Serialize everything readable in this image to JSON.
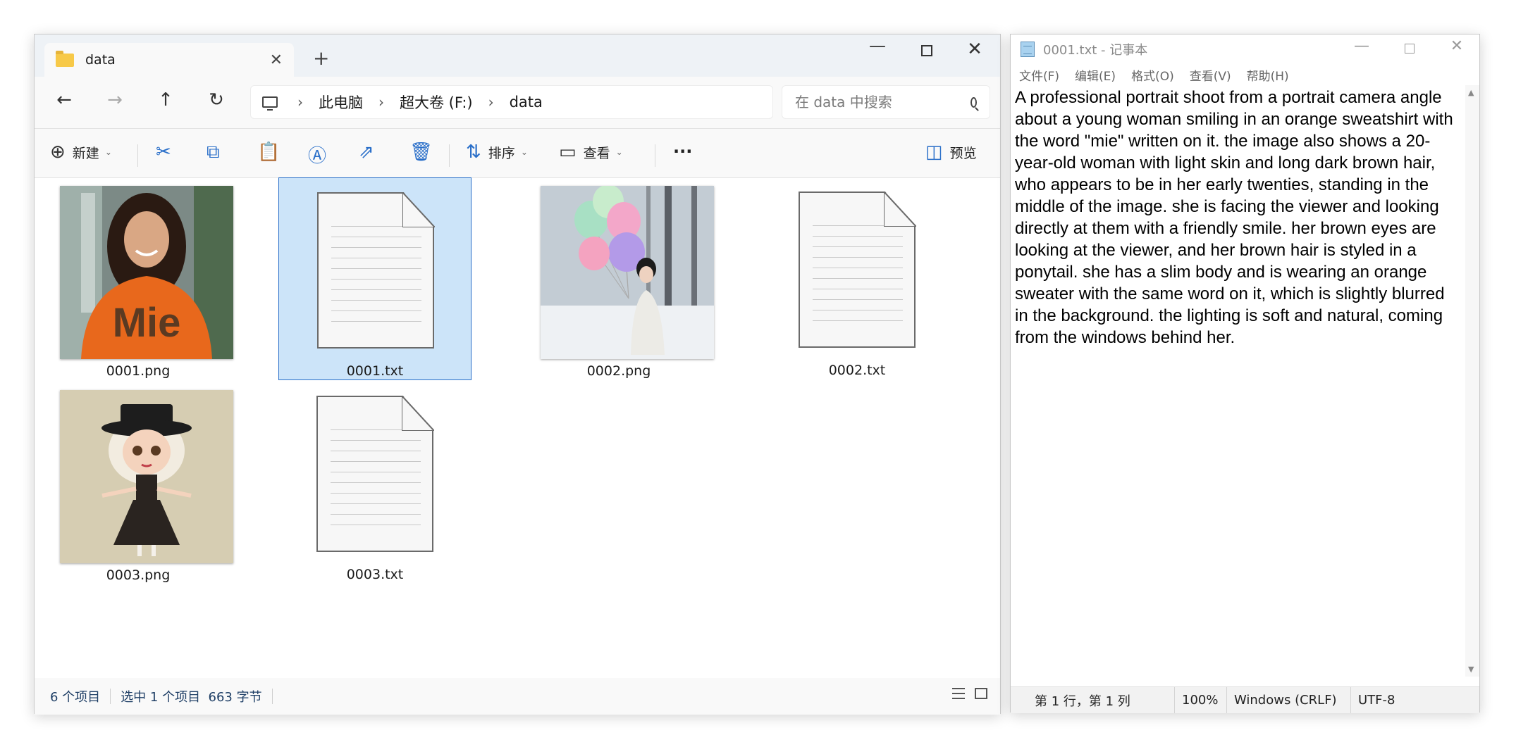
{
  "explorer": {
    "tab_title": "data",
    "nav": {
      "back": "←",
      "forward": "→",
      "up": "↑",
      "refresh": "↻"
    },
    "breadcrumb": [
      "此电脑",
      "超大卷 (F:)",
      "data"
    ],
    "search_placeholder": "在 data 中搜索",
    "toolbar": {
      "new_label": "新建",
      "sort_label": "排序",
      "view_label": "查看",
      "more_label": "···",
      "preview_label": "预览"
    },
    "files": [
      {
        "name": "0001.png",
        "kind": "image",
        "selected": false
      },
      {
        "name": "0001.txt",
        "kind": "text",
        "selected": true
      },
      {
        "name": "0002.png",
        "kind": "image",
        "selected": false
      },
      {
        "name": "0002.txt",
        "kind": "text",
        "selected": false
      },
      {
        "name": "0003.png",
        "kind": "image",
        "selected": false
      },
      {
        "name": "0003.txt",
        "kind": "text",
        "selected": false
      }
    ],
    "status": {
      "count": "6 个项目",
      "selection": "选中 1 个项目  663 字节"
    }
  },
  "notepad": {
    "title": "0001.txt - 记事本",
    "menu": [
      "文件(F)",
      "编辑(E)",
      "格式(O)",
      "查看(V)",
      "帮助(H)"
    ],
    "content": "A professional portrait shoot from a portrait camera angle about a young woman smiling in an orange sweatshirt with the word \"mie\" written on it. the image also shows a 20-year-old woman with light skin and long dark brown hair, who appears to be in her early twenties, standing in the middle of the image. she is facing the viewer and looking directly at them with a friendly smile. her brown eyes are looking at the viewer, and her brown hair is styled in a ponytail. she has a slim body and is wearing an orange sweater with the same word on it, which is slightly blurred in the background. the lighting is soft and natural, coming from the windows behind her.",
    "status": {
      "position": "第 1 行，第 1 列",
      "zoom": "100%",
      "line_ending": "Windows (CRLF)",
      "encoding": "UTF-8"
    }
  },
  "colors": {
    "accent": "#2a6fc9",
    "selection_bg": "#cce4f9",
    "sweater": "#e8681c"
  }
}
